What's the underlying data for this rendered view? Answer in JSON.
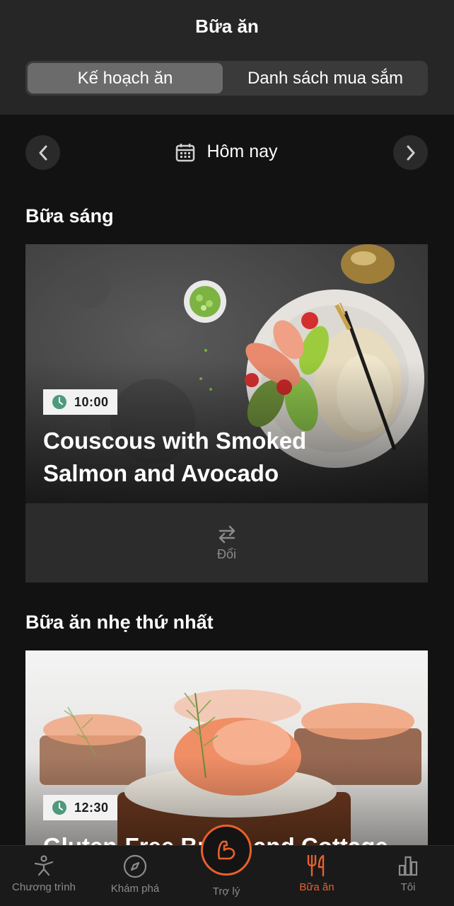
{
  "header": {
    "title": "Bữa ăn",
    "tabs": [
      {
        "label": "Kế hoạch ăn",
        "active": true
      },
      {
        "label": "Danh sách mua sắm",
        "active": false
      }
    ]
  },
  "date_nav": {
    "label": "Hôm nay",
    "icons": {
      "prev": "chevron-left-icon",
      "next": "chevron-right-icon",
      "calendar": "calendar-icon"
    }
  },
  "meals": [
    {
      "section": "Bữa sáng",
      "time": "10:00",
      "name": "Couscous with Smoked Salmon and Avocado",
      "swap_label": "Đổi"
    },
    {
      "section": "Bữa ăn nhẹ thứ nhất",
      "time": "12:30",
      "name": "Gluten-Free Bread and Cottage"
    }
  ],
  "bottom_nav": {
    "items": [
      {
        "label": "Chương trình",
        "icon": "stretching-person-icon"
      },
      {
        "label": "Khám phá",
        "icon": "compass-icon"
      },
      {
        "label": "Trợ lý",
        "icon": "flexed-arm-icon"
      },
      {
        "label": "Bữa ăn",
        "icon": "fork-knife-icon",
        "active": true
      },
      {
        "label": "Tôi",
        "icon": "bar-chart-icon"
      }
    ]
  },
  "colors": {
    "accent": "#e8602c",
    "background": "#121212",
    "header": "#262626",
    "clock": "#4f9a7c"
  }
}
